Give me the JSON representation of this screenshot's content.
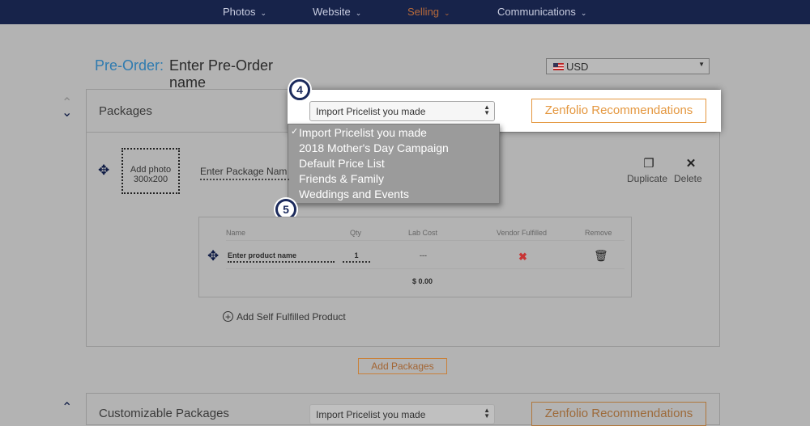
{
  "nav": {
    "items": [
      {
        "label": "Photos"
      },
      {
        "label": "Website"
      },
      {
        "label": "Selling"
      },
      {
        "label": "Communications"
      }
    ]
  },
  "header": {
    "preorder_label": "Pre-Order:",
    "preorder_name": "Enter Pre-Order name",
    "currency": "USD"
  },
  "packages": {
    "title": "Packages",
    "pricelist_select": "Import Pricelist you made",
    "recommendations_button": "Zenfolio Recommendations",
    "dropdown": {
      "options": [
        "Import Pricelist you made",
        "2018 Mother's Day Campaign",
        "Default Price List",
        "Friends & Family",
        "Weddings and Events"
      ],
      "selected": "Import Pricelist you made"
    },
    "steps": {
      "step4": "4",
      "step5": "5"
    },
    "photo_placeholder": {
      "line1": "Add photo",
      "line2": "300x200"
    },
    "package_name_placeholder": "Enter Package Nam",
    "duplicate_label": "Duplicate",
    "delete_label": "Delete",
    "table": {
      "headers": {
        "name": "Name",
        "qty": "Qty",
        "lab_cost": "Lab Cost",
        "vendor": "Vendor Fulfilled",
        "remove": "Remove"
      },
      "row": {
        "name": "Enter product name",
        "qty": "1",
        "lab_cost": "---"
      },
      "total": "$ 0.00"
    },
    "add_self_fulfilled": "Add Self Fulfilled Product",
    "add_packages": "Add Packages"
  },
  "customizable": {
    "title": "Customizable Packages",
    "pricelist_select": "Import Pricelist you made",
    "recommendations_button": "Zenfolio Recommendations"
  }
}
